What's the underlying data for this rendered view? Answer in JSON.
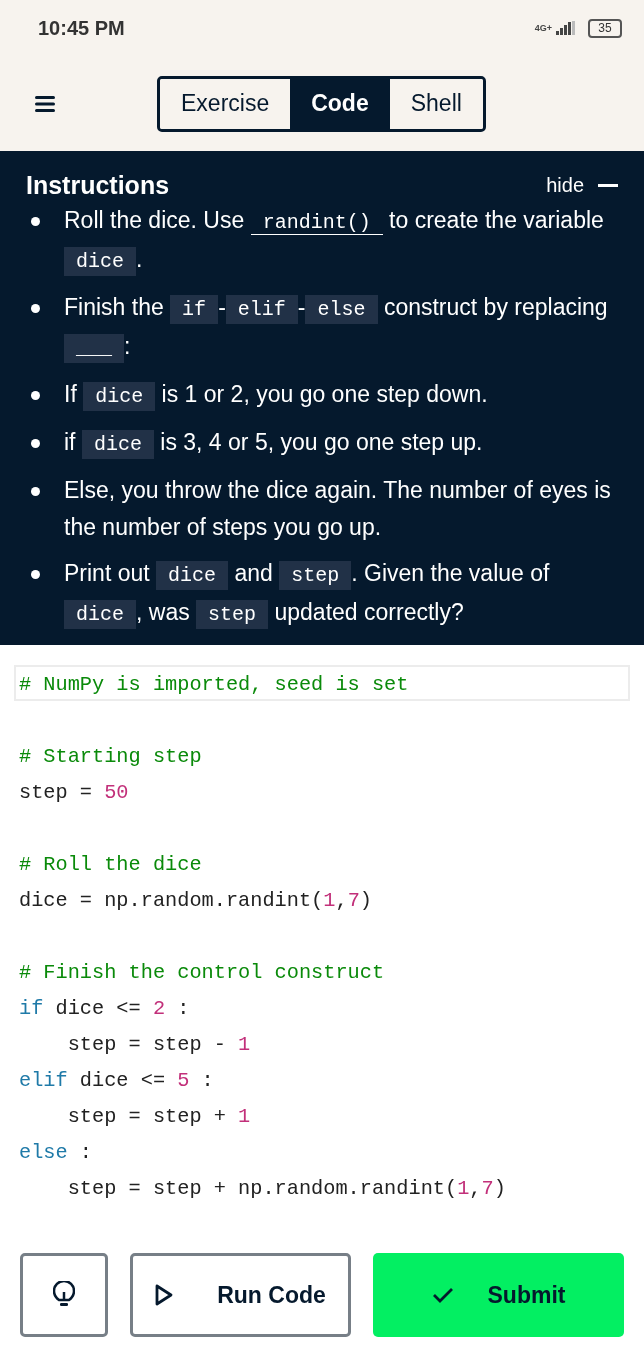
{
  "status_bar": {
    "time": "10:45 PM",
    "network": "4G+",
    "battery": "35"
  },
  "tabs": [
    {
      "label": "Exercise",
      "selected": false
    },
    {
      "label": "Code",
      "selected": true
    },
    {
      "label": "Shell",
      "selected": false
    }
  ],
  "instructions": {
    "title": "Instructions",
    "toggle": "hide",
    "items": [
      [
        {
          "kind": "text",
          "text": "Roll the dice. Use "
        },
        {
          "kind": "link",
          "text": "randint()"
        },
        {
          "kind": "text",
          "text": " to create the variable "
        },
        {
          "kind": "code",
          "text": "dice"
        },
        {
          "kind": "text",
          "text": "."
        }
      ],
      [
        {
          "kind": "text",
          "text": "Finish the "
        },
        {
          "kind": "code",
          "text": "if"
        },
        {
          "kind": "text",
          "text": "-"
        },
        {
          "kind": "code",
          "text": "elif"
        },
        {
          "kind": "text",
          "text": "-"
        },
        {
          "kind": "code",
          "text": "else"
        },
        {
          "kind": "text",
          "text": " construct by replacing "
        },
        {
          "kind": "code",
          "text": "___"
        },
        {
          "kind": "text",
          "text": ":"
        }
      ],
      [
        {
          "kind": "text",
          "text": "If "
        },
        {
          "kind": "code",
          "text": "dice"
        },
        {
          "kind": "text",
          "text": " is 1 or 2, you go one step down."
        }
      ],
      [
        {
          "kind": "text",
          "text": "if "
        },
        {
          "kind": "code",
          "text": "dice"
        },
        {
          "kind": "text",
          "text": " is 3, 4 or 5, you go one step up."
        }
      ],
      [
        {
          "kind": "text",
          "text": "Else, you throw the dice again. The number of eyes is the number of steps you go up."
        }
      ],
      [
        {
          "kind": "text",
          "text": "Print out "
        },
        {
          "kind": "code",
          "text": "dice"
        },
        {
          "kind": "text",
          "text": " and "
        },
        {
          "kind": "code",
          "text": "step"
        },
        {
          "kind": "text",
          "text": ". Given the value of "
        },
        {
          "kind": "code",
          "text": "dice"
        },
        {
          "kind": "text",
          "text": ", was "
        },
        {
          "kind": "code",
          "text": "step"
        },
        {
          "kind": "text",
          "text": " updated correctly?"
        }
      ]
    ]
  },
  "code_lines": [
    {
      "kind": "code",
      "highlighted": true,
      "tokens": [
        {
          "kind": "comment",
          "text": "# NumPy is imported, seed is set"
        }
      ]
    },
    {
      "kind": "blank",
      "highlighted": false
    },
    {
      "kind": "code",
      "highlighted": false,
      "tokens": [
        {
          "kind": "comment",
          "text": "# Starting step"
        }
      ]
    },
    {
      "kind": "code",
      "highlighted": false,
      "tokens": [
        {
          "kind": "plain",
          "text": "step = "
        },
        {
          "kind": "number",
          "text": "50"
        }
      ]
    },
    {
      "kind": "blank",
      "highlighted": false
    },
    {
      "kind": "code",
      "highlighted": false,
      "tokens": [
        {
          "kind": "comment",
          "text": "# Roll the dice"
        }
      ]
    },
    {
      "kind": "code",
      "highlighted": false,
      "tokens": [
        {
          "kind": "plain",
          "text": "dice = np.random.randint("
        },
        {
          "kind": "number",
          "text": "1"
        },
        {
          "kind": "plain",
          "text": ","
        },
        {
          "kind": "number",
          "text": "7"
        },
        {
          "kind": "plain",
          "text": ")"
        }
      ]
    },
    {
      "kind": "blank",
      "highlighted": false
    },
    {
      "kind": "code",
      "highlighted": false,
      "tokens": [
        {
          "kind": "comment",
          "text": "# Finish the control construct"
        }
      ]
    },
    {
      "kind": "code",
      "highlighted": false,
      "tokens": [
        {
          "kind": "keyword",
          "text": "if"
        },
        {
          "kind": "plain",
          "text": " dice <= "
        },
        {
          "kind": "number",
          "text": "2"
        },
        {
          "kind": "plain",
          "text": " :"
        }
      ]
    },
    {
      "kind": "code",
      "highlighted": false,
      "tokens": [
        {
          "kind": "plain",
          "text": "    step = step - "
        },
        {
          "kind": "number",
          "text": "1"
        }
      ]
    },
    {
      "kind": "code",
      "highlighted": false,
      "tokens": [
        {
          "kind": "keyword",
          "text": "elif"
        },
        {
          "kind": "plain",
          "text": " dice <= "
        },
        {
          "kind": "number",
          "text": "5"
        },
        {
          "kind": "plain",
          "text": " :"
        }
      ]
    },
    {
      "kind": "code",
      "highlighted": false,
      "tokens": [
        {
          "kind": "plain",
          "text": "    step = step + "
        },
        {
          "kind": "number",
          "text": "1"
        }
      ]
    },
    {
      "kind": "code",
      "highlighted": false,
      "tokens": [
        {
          "kind": "keyword",
          "text": "else"
        },
        {
          "kind": "plain",
          "text": " :"
        }
      ]
    },
    {
      "kind": "code",
      "highlighted": false,
      "tokens": [
        {
          "kind": "plain",
          "text": "    step = step + np.random.randint("
        },
        {
          "kind": "number",
          "text": "1"
        },
        {
          "kind": "plain",
          "text": ","
        },
        {
          "kind": "number",
          "text": "7"
        },
        {
          "kind": "plain",
          "text": ")"
        }
      ]
    }
  ],
  "actions": {
    "run": "Run Code",
    "submit": "Submit"
  }
}
